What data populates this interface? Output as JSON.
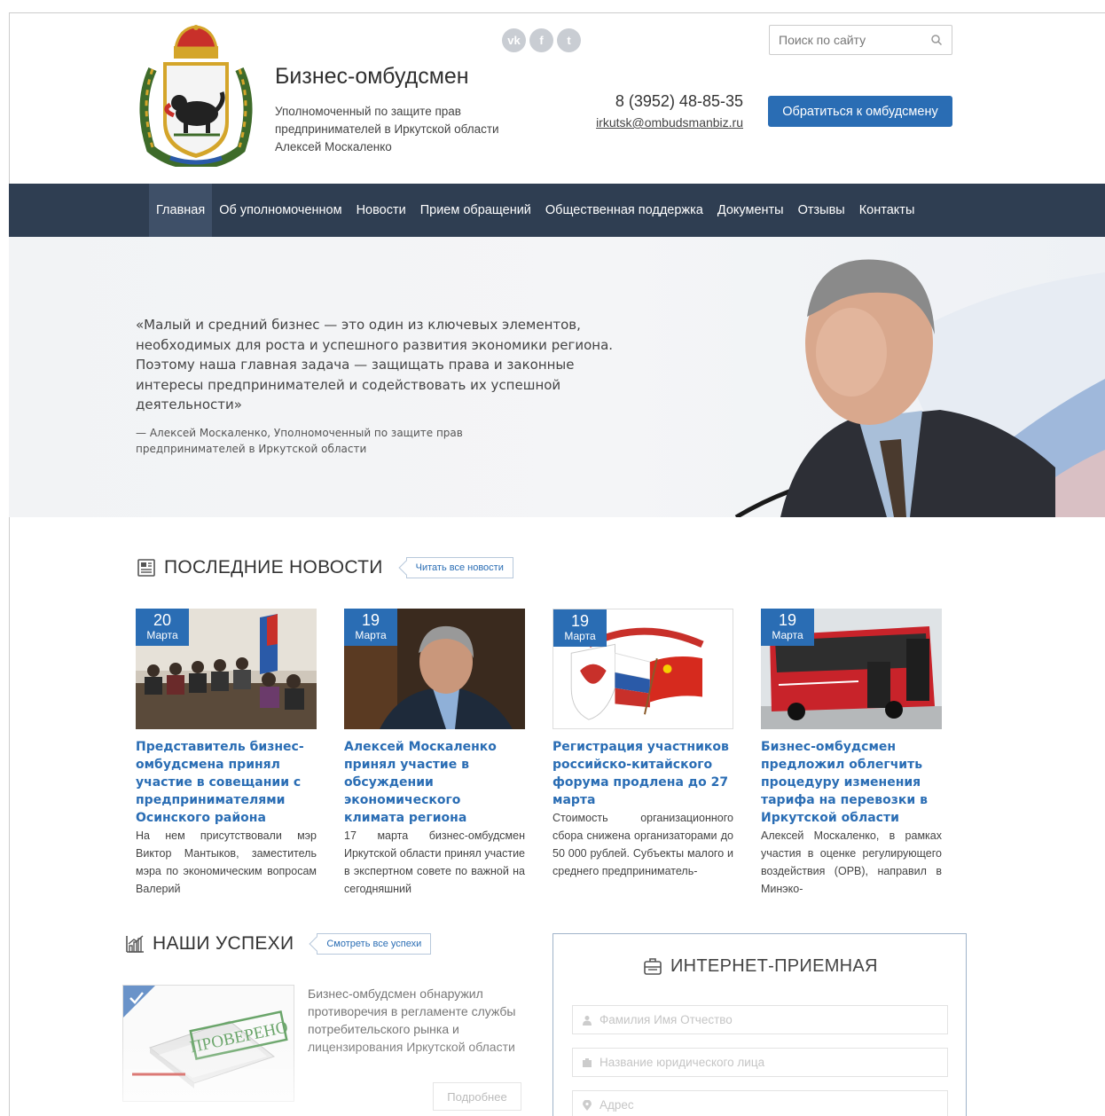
{
  "header": {
    "title": "Бизнес-омбудсмен",
    "subtitle": "Уполномоченный по защите прав предпринимателей в Иркутской области Алексей Москаленко",
    "phone": "8 (3952) 48-85-35",
    "email": "irkutsk@ombudsmanbiz.ru",
    "search_placeholder": "Поиск по сайту",
    "contact_button": "Обратиться к омбудсмену",
    "social": [
      "vk-icon",
      "facebook-icon",
      "twitter-icon"
    ]
  },
  "nav": {
    "items": [
      "Главная",
      "Об уполномоченном",
      "Новости",
      "Прием обращений",
      "Общественная поддержка",
      "Документы",
      "Отзывы",
      "Контакты"
    ]
  },
  "hero": {
    "quote": "«Малый и средний бизнес — это один из ключевых элементов, необходимых для роста и успешного развития экономики региона. Поэтому наша главная задача — защищать права и законные интересы предпринимателей и содействовать их успешной деятельности»",
    "author": "— Алексей Москаленко, Уполномоченный по защите прав предпринимателей в Иркутской области"
  },
  "news": {
    "title": "ПОСЛЕДНИЕ НОВОСТИ",
    "all_link": "Читать все новости",
    "items": [
      {
        "day": "20",
        "month": "Марта",
        "title": "Представитель бизнес-омбудсмена принял участие в совещании с предпринимателями Осинского района",
        "text": "На нем присутствовали мэр Виктор Мантыков, заместитель мэра по экономическим вопросам Валерий"
      },
      {
        "day": "19",
        "month": "Марта",
        "title": "Алексей Москаленко принял участие в обсуждении экономического климата региона",
        "text": "17 марта бизнес-омбудсмен Иркутской области принял участие в экспертном совете по важной на сегодняшний"
      },
      {
        "day": "19",
        "month": "Марта",
        "title": "Регистрация участников российско-китайского форума продлена до 27 марта",
        "text": "Стоимость организационного сбора снижена организаторами до 50 000 рублей. Субъекты малого и среднего предприниматель-"
      },
      {
        "day": "19",
        "month": "Марта",
        "title": "Бизнес-омбудсмен предложил облегчить процедуру изменения тарифа на перевозки в Иркутской области",
        "text": "Алексей Москаленко, в рамках участия в оценке регулирующего воздействия (ОРВ), направил в Минэко-"
      }
    ]
  },
  "successes": {
    "title": "НАШИ УСПЕХИ",
    "all_link": "Смотреть все успехи",
    "stamp": "ПРОВЕРЕНО",
    "text": "Бизнес-омбудсмен обнаружил противоречия в регламенте службы потребительского рынка и лицензирования Иркутской области",
    "more": "Подробнее"
  },
  "reception": {
    "title": "ИНТЕРНЕТ-ПРИЕМНАЯ",
    "fields": [
      "Фамилия Имя Отчество",
      "Название юридического лица",
      "Адрес"
    ]
  },
  "colors": {
    "accent": "#2a6db4",
    "nav_bg": "#2f3e52"
  }
}
